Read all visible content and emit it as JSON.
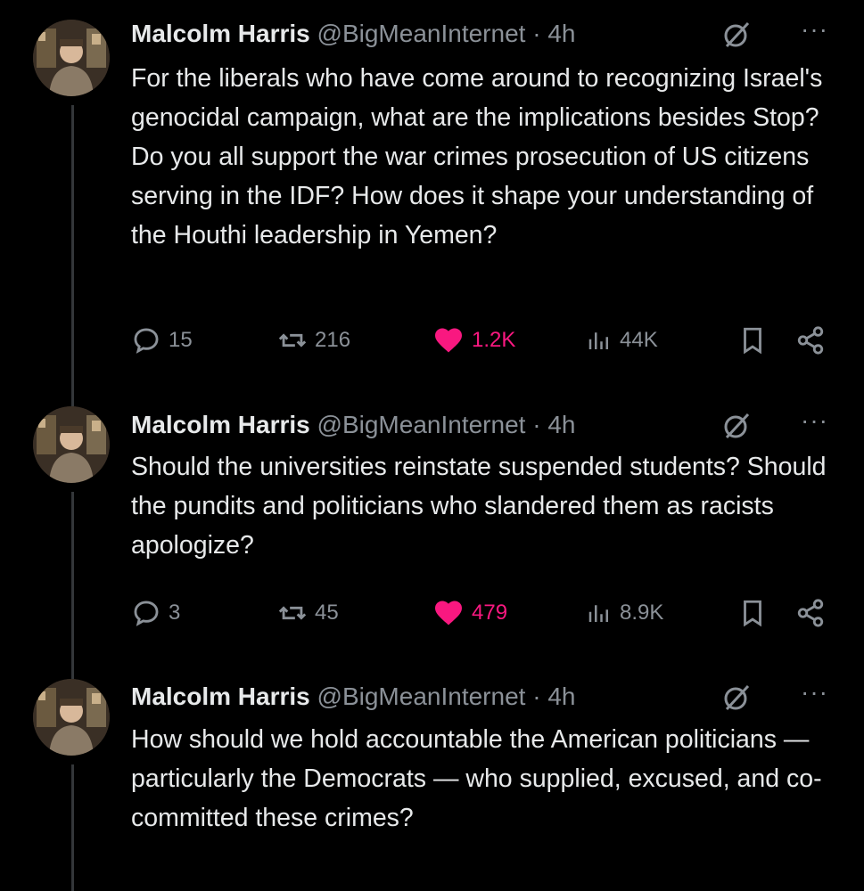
{
  "colors": {
    "background": "#000000",
    "text": "#e7e9ea",
    "muted": "#8b9198",
    "like": "#f91880"
  },
  "tweets": [
    {
      "author": "Malcolm Harris",
      "handle": "@BigMeanInternet",
      "separator": "·",
      "time": "4h",
      "text": "For the liberals who have come around to recognizing Israel's genocidal campaign, what are the implications besides Stop? Do you all support the war crimes prosecution of US citizens serving in the IDF? How does it shape your understanding of the Houthi leadership in Yemen?",
      "replies": "15",
      "reposts": "216",
      "likes": "1.2K",
      "views": "44K"
    },
    {
      "author": "Malcolm Harris",
      "handle": "@BigMeanInternet",
      "separator": "·",
      "time": "4h",
      "text": "Should the universities reinstate suspended students? Should the pundits and politicians who slandered them as racists apologize?",
      "replies": "3",
      "reposts": "45",
      "likes": "479",
      "views": "8.9K"
    },
    {
      "author": "Malcolm Harris",
      "handle": "@BigMeanInternet",
      "separator": "·",
      "time": "4h",
      "text": "How should we hold accountable the American politicians — particularly the Democrats — who supplied, excused, and co-committed these crimes?"
    }
  ],
  "icons": {
    "reply": "reply-icon",
    "repost": "repost-icon",
    "like": "heart-icon",
    "views": "views-icon",
    "bookmark": "bookmark-icon",
    "share": "share-icon",
    "grok": "grok-icon",
    "more": "more-icon"
  }
}
